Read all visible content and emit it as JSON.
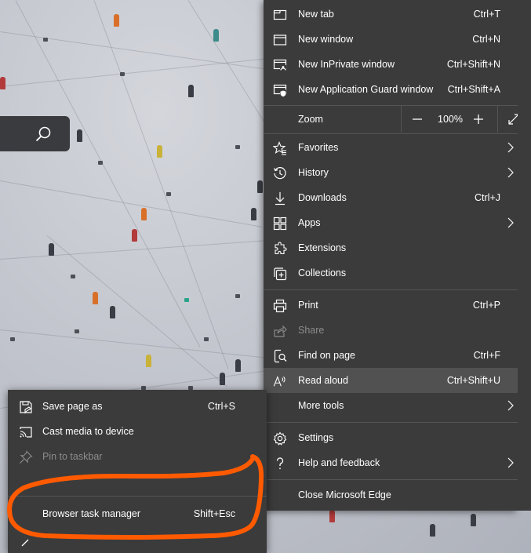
{
  "menu": {
    "items": [
      {
        "label": "New tab",
        "shortcut": "Ctrl+T",
        "icon": "new-tab-icon"
      },
      {
        "label": "New window",
        "shortcut": "Ctrl+N",
        "icon": "new-window-icon"
      },
      {
        "label": "New InPrivate window",
        "shortcut": "Ctrl+Shift+N",
        "icon": "inprivate-icon"
      },
      {
        "label": "New Application Guard window",
        "shortcut": "Ctrl+Shift+A",
        "icon": "application-guard-icon"
      }
    ],
    "zoom": {
      "label": "Zoom",
      "value": "100%",
      "minus": "—",
      "plus": "+"
    },
    "items2": [
      {
        "label": "Favorites",
        "icon": "favorites-icon"
      },
      {
        "label": "History",
        "icon": "history-icon"
      },
      {
        "label": "Downloads",
        "shortcut": "Ctrl+J",
        "icon": "downloads-icon"
      },
      {
        "label": "Apps",
        "icon": "apps-icon"
      },
      {
        "label": "Extensions",
        "icon": "extensions-icon"
      },
      {
        "label": "Collections",
        "icon": "collections-icon"
      }
    ],
    "items3": [
      {
        "label": "Print",
        "shortcut": "Ctrl+P",
        "icon": "print-icon"
      },
      {
        "label": "Share",
        "icon": "share-icon"
      },
      {
        "label": "Find on page",
        "shortcut": "Ctrl+F",
        "icon": "find-icon"
      },
      {
        "label": "Read aloud",
        "shortcut": "Ctrl+Shift+U",
        "icon": "read-aloud-icon"
      },
      {
        "label": "More tools"
      }
    ],
    "items4": [
      {
        "label": "Settings",
        "icon": "settings-icon"
      },
      {
        "label": "Help and feedback",
        "icon": "help-icon"
      }
    ],
    "close": {
      "label": "Close Microsoft Edge"
    }
  },
  "submenu": {
    "items": [
      {
        "label": "Save page as",
        "shortcut": "Ctrl+S",
        "icon": "save-icon"
      },
      {
        "label": "Cast media to device",
        "icon": "cast-icon"
      },
      {
        "label": "Pin to taskbar",
        "icon": "pin-icon"
      },
      {
        "label": "Browser task manager",
        "shortcut": "Shift+Esc"
      }
    ]
  },
  "colors": {
    "menu_bg": "#3b3b3b",
    "hover_bg": "#515151",
    "separator": "#555555",
    "disabled_text": "#8c8c8c",
    "annotation": "#ff5a00"
  }
}
